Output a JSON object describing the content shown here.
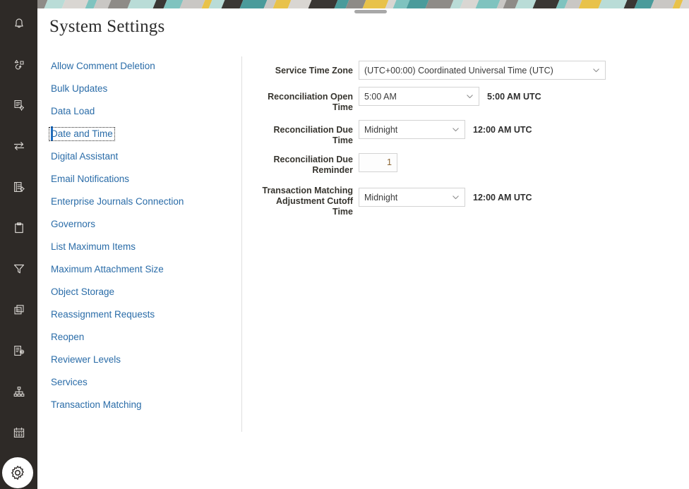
{
  "page": {
    "title": "System Settings"
  },
  "banner": {
    "drag_handle": "window-drag-handle",
    "colors": [
      "#4a9b9b",
      "#e8c24a",
      "#3a3734",
      "#c9c7c4",
      "#b9dcd7",
      "#7fc3bf",
      "#8e8b87",
      "#d9d6d2"
    ]
  },
  "rail": {
    "items": [
      {
        "name": "notifications-bell-icon",
        "label": "Notifications"
      },
      {
        "name": "process-workflow-icon",
        "label": "Workflow"
      },
      {
        "name": "document-settings-icon",
        "label": "Document Settings"
      },
      {
        "name": "transfer-exchange-icon",
        "label": "Transfer"
      },
      {
        "name": "journal-settings-icon",
        "label": "Journals"
      },
      {
        "name": "clipboard-icon",
        "label": "Tasks"
      },
      {
        "name": "filter-icon",
        "label": "Filters"
      },
      {
        "name": "copy-documents-icon",
        "label": "Documents"
      },
      {
        "name": "document-view-icon",
        "label": "Review"
      },
      {
        "name": "hierarchy-icon",
        "label": "Hierarchy"
      },
      {
        "name": "calendar-icon",
        "label": "Calendar"
      },
      {
        "name": "settings-gear-icon",
        "label": "Settings"
      }
    ],
    "active_index": 11
  },
  "settings_list": {
    "selected": "Date and Time",
    "items": [
      {
        "label": "Allow Comment Deletion"
      },
      {
        "label": "Bulk Updates"
      },
      {
        "label": "Data Load"
      },
      {
        "label": "Date and Time"
      },
      {
        "label": "Digital Assistant"
      },
      {
        "label": "Email Notifications"
      },
      {
        "label": "Enterprise Journals Connection"
      },
      {
        "label": "Governors"
      },
      {
        "label": "List Maximum Items"
      },
      {
        "label": "Maximum Attachment Size"
      },
      {
        "label": "Object Storage"
      },
      {
        "label": "Reassignment Requests"
      },
      {
        "label": "Reopen"
      },
      {
        "label": "Reviewer Levels"
      },
      {
        "label": "Services"
      },
      {
        "label": "Transaction Matching"
      }
    ]
  },
  "form": {
    "service_time_zone": {
      "label": "Service Time Zone",
      "value": "(UTC+00:00) Coordinated Universal Time (UTC)"
    },
    "reconciliation_open_time": {
      "label": "Reconciliation Open Time",
      "value": "5:00 AM",
      "suffix": "5:00 AM UTC"
    },
    "reconciliation_due_time": {
      "label": "Reconciliation Due Time",
      "value": "Midnight",
      "suffix": "12:00 AM UTC"
    },
    "reconciliation_due_reminder": {
      "label_line1": "Reconciliation Due",
      "label_line2": "Reminder",
      "value": "1"
    },
    "transaction_matching_cutoff": {
      "label_line1": "Transaction Matching",
      "label_line2": "Adjustment Cutoff Time",
      "value": "Midnight",
      "suffix": "12:00 AM UTC"
    }
  },
  "colors": {
    "rail_background": "#2e2a27",
    "link": "#2a6ca8",
    "selected_bar": "#1a6ec8",
    "label": "#37352f",
    "number_value": "#8a6432"
  }
}
